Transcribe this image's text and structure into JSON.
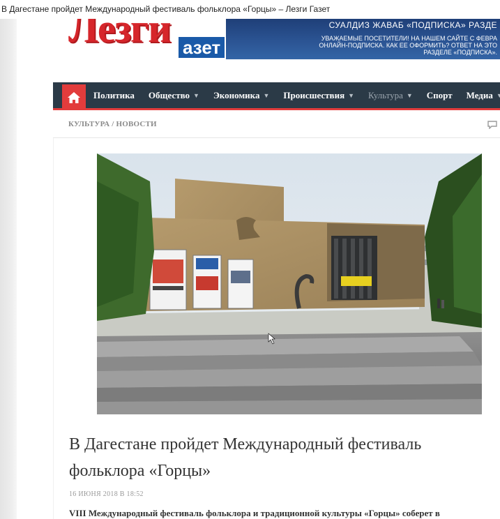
{
  "window": {
    "title": "В Дагестане пройдет Международный фестиваль фольклора «Горцы» – Лезги Газет"
  },
  "header": {
    "logo_main": "Лезги",
    "logo_sub": "азет",
    "banner_title": "СУАЛДИЗ ЖАВАБ «ПОДПИСКА» РАЗДЕ",
    "banner_text": "УВАЖАЕМЫЕ ПОСЕТИТЕЛИ! НА НАШЕМ САЙТЕ С ФЕВРА\nОНЛАЙН-ПОДПИСКА. КАК ЕЕ ОФОРМИТЬ? ОТВЕТ НА ЭТО\nРАЗДЕЛЕ «ПОДПИСКА»."
  },
  "nav": {
    "home_icon": "home-icon",
    "items": [
      {
        "label": "Политика"
      },
      {
        "label": "Общество"
      },
      {
        "label": "Экономика"
      },
      {
        "label": "Происшествия"
      },
      {
        "label": "Культура"
      },
      {
        "label": "Спорт"
      },
      {
        "label": "Медиа"
      }
    ]
  },
  "breadcrumb": {
    "text": "КУЛЬТУРА / НОВОСТИ"
  },
  "article": {
    "title": "В Дагестане пройдет Международный фестиваль фольклора «Горцы»",
    "date": "16 ИЮНЯ 2018 В 18:52",
    "lead": "VIII Международный фестиваль фольклора и традиционной культуры «Горцы» соберет в"
  },
  "colors": {
    "nav_bg": "#2b3a47",
    "accent": "#e23c3c",
    "logo_red": "#d6262b",
    "logo_blue": "#1a5aa8",
    "banner_blue": "#2b5493"
  }
}
